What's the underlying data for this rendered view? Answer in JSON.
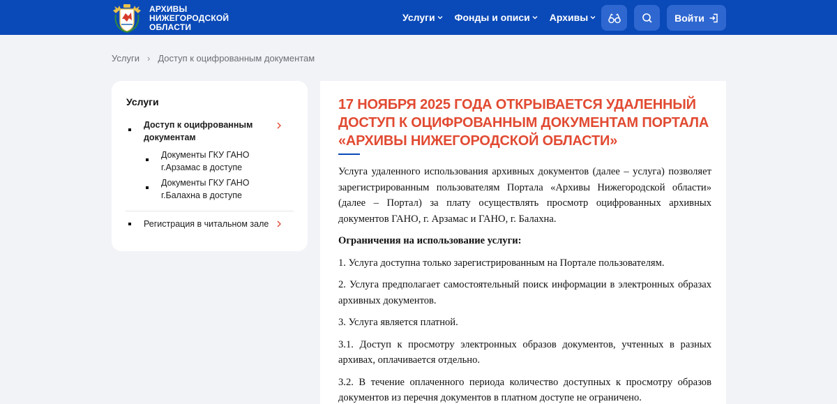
{
  "header": {
    "logo_lines": [
      "АРХИВЫ",
      "НИЖЕГОРОДСКОЙ",
      "ОБЛАСТИ"
    ],
    "nav": [
      {
        "label": "Услуги"
      },
      {
        "label": "Фонды и описи"
      },
      {
        "label": "Архивы"
      }
    ],
    "login_label": "Войти"
  },
  "breadcrumb": {
    "root": "Услуги",
    "current": "Доступ к оцифрованным документам"
  },
  "sidebar": {
    "title": "Услуги",
    "main_item": "Доступ к оцифрованным документам",
    "sub_items": [
      "Документы ГКУ ГАНО г.Арзамас в доступе",
      "Документы ГКУ ГАНО г.Балахна в доступе"
    ],
    "second_item": "Регистрация в читальном зале"
  },
  "article": {
    "title_lines": [
      "17 НОЯБРЯ 2025 ГОДА ОТКРЫВАЕТСЯ УДАЛЕННЫЙ",
      "ДОСТУП К ОЦИФРОВАННЫМ ДОКУМЕНТАМ ПОРТАЛА",
      "«АРХИВЫ НИЖЕГОРОДСКОЙ ОБЛАСТИ»"
    ],
    "intro": "Услуга удаленного использования архивных документов (далее – услуга) позволяет зарегистрированным пользователям Портала «Архивы Нижегородской области» (далее – Портал) за плату осуществлять просмотр оцифрованных архивных документов ГАНО, г. Арзамас и ГАНО, г. Балахна.",
    "restrictions_heading": "Ограничения на использование услуги:",
    "points": [
      "1.  Услуга доступна только зарегистрированным на Портале пользователям.",
      "2. Услуга предполагает самостоятельный поиск информации в электронных образах архивных документов.",
      "3. Услуга является платной.",
      "3.1. Доступ к просмотру электронных образов документов, учтенных в разных архивах, оплачивается отдельно.",
      "3.2. В течение оплаченного периода количество доступных к просмотру образов документов из перечня документов в платном доступе не ограничено."
    ]
  },
  "colors": {
    "header_bg": "#0a49b8",
    "title_red": "#e14a32",
    "page_bg": "#f2f3f7"
  },
  "icons": [
    "coat-of-arms-icon",
    "chevron-down-icon",
    "glasses-icon",
    "search-icon",
    "login-icon",
    "chevron-right-icon"
  ]
}
